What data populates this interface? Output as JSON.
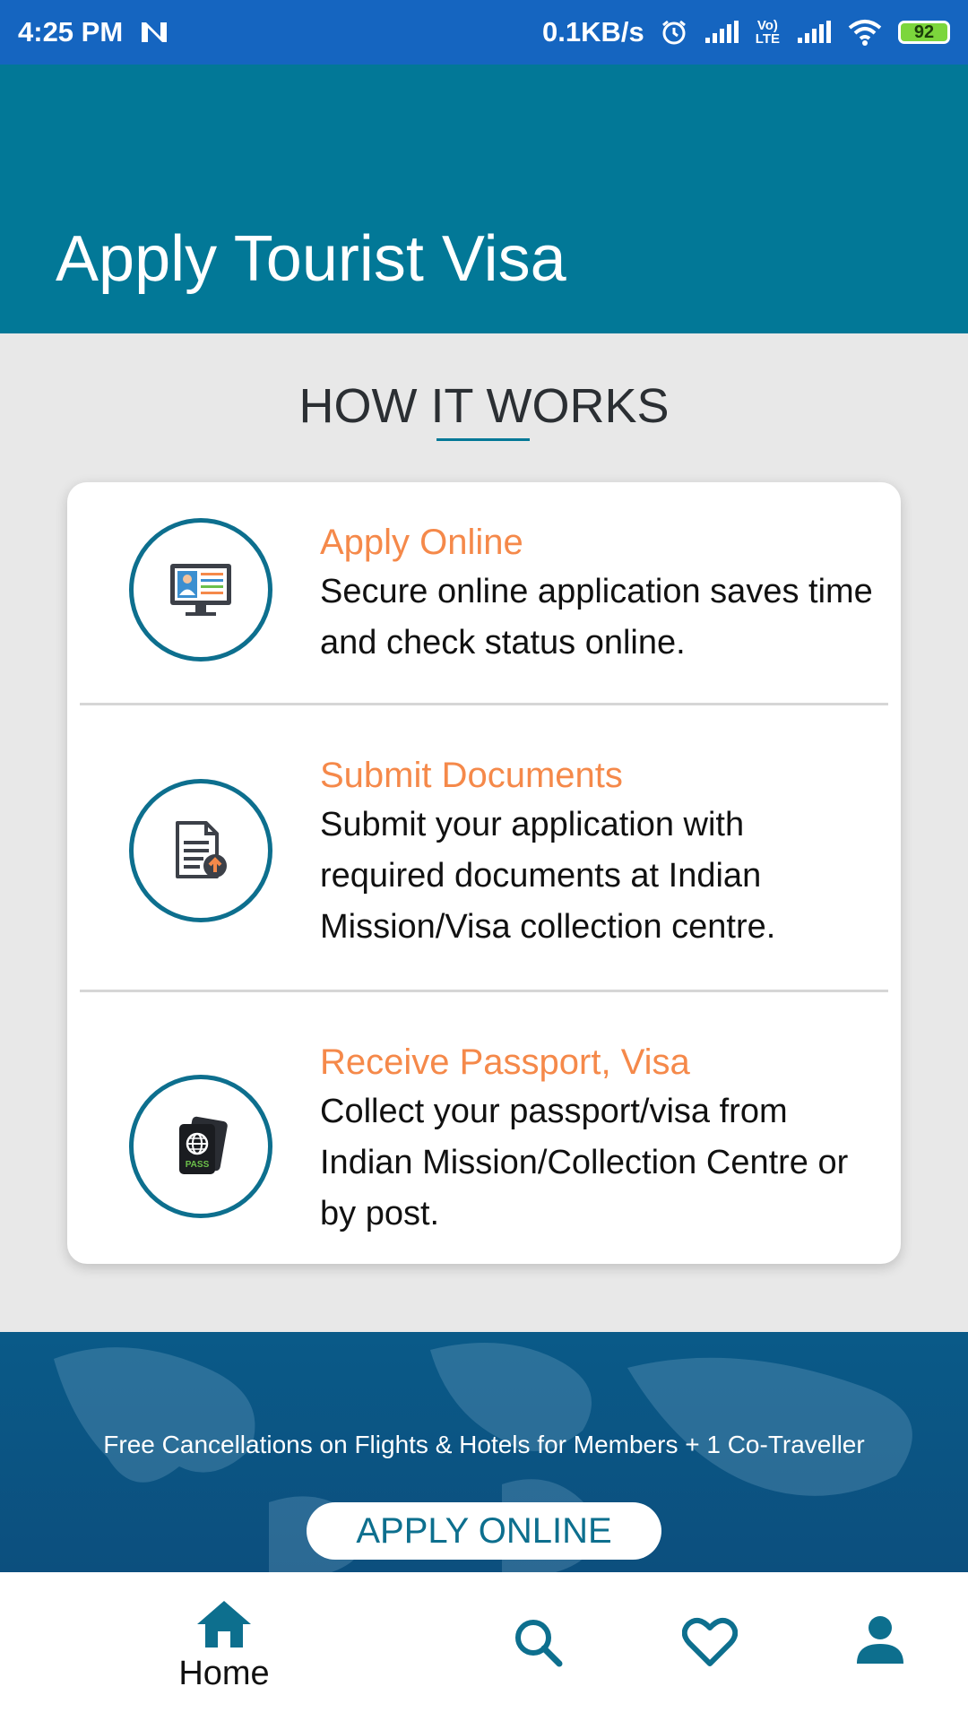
{
  "status_bar": {
    "time": "4:25 PM",
    "network_speed": "0.1KB/s",
    "battery": "92",
    "lte_top": "Vo)",
    "lte_bottom": "LTE",
    "icons": [
      "n-notification-icon",
      "alarm-icon",
      "signal-icon",
      "volte-icon",
      "signal-icon",
      "wifi-icon",
      "battery-icon"
    ]
  },
  "header": {
    "title": "Apply Tourist Visa"
  },
  "how_it_works": {
    "title": "HOW IT WORKS",
    "steps": [
      {
        "icon": "online-application-icon",
        "title": "Apply Online",
        "description": "Secure online application saves time and check status online."
      },
      {
        "icon": "document-upload-icon",
        "title": "Submit Documents",
        "description": "Submit your application with required documents at Indian Mission/Visa collection centre."
      },
      {
        "icon": "passport-icon",
        "title": "Receive Passport, Visa",
        "description": "Collect your passport/visa from Indian Mission/Collection Centre or by post.",
        "passport_label": "PASS"
      }
    ]
  },
  "banner": {
    "text": "Free Cancellations on Flights & Hotels for Members + 1 Co-Traveller",
    "button_label": "APPLY ONLINE"
  },
  "bottom_nav": {
    "items": [
      {
        "name": "home",
        "label": "Home",
        "icon": "home-icon",
        "active": true
      },
      {
        "name": "search",
        "label": "",
        "icon": "search-icon"
      },
      {
        "name": "favorites",
        "label": "",
        "icon": "heart-icon"
      },
      {
        "name": "profile",
        "label": "",
        "icon": "person-icon"
      }
    ]
  },
  "colors": {
    "status_bar": "#1565c0",
    "header": "#027897",
    "accent_orange": "#f5894a",
    "teal": "#0d6f8e",
    "banner": "#0c4f7e"
  }
}
